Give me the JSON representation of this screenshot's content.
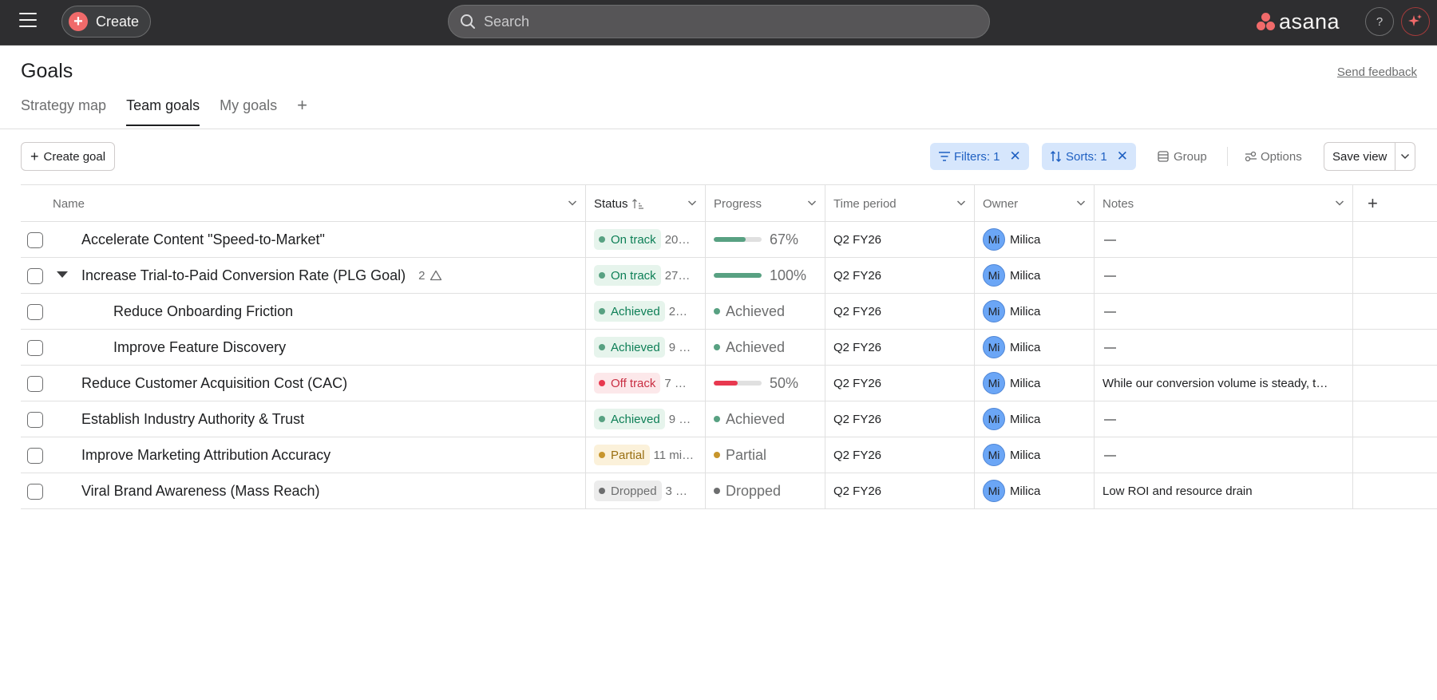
{
  "topbar": {
    "create_label": "Create",
    "search_placeholder": "Search",
    "logo_text": "asana",
    "help_label": "?",
    "icons": [
      "hamburger-icon",
      "plus-icon",
      "search-icon",
      "asana-logo",
      "help-icon",
      "ai-sparkle-icon"
    ],
    "colors": {
      "bar": "#2e2e30",
      "brand": "#f06a6a"
    }
  },
  "header": {
    "title": "Goals",
    "feedback_label": "Send feedback",
    "tabs": [
      {
        "label": "Strategy map",
        "active": false
      },
      {
        "label": "Team goals",
        "active": true
      },
      {
        "label": "My goals",
        "active": false
      }
    ],
    "add_tab_label": "+"
  },
  "toolbar": {
    "create_goal_label": "Create goal",
    "filters_label": "Filters: 1",
    "sorts_label": "Sorts: 1",
    "group_label": "Group",
    "options_label": "Options",
    "save_view_label": "Save view"
  },
  "table": {
    "columns": {
      "name": "Name",
      "status": "Status",
      "progress": "Progress",
      "time_period": "Time period",
      "owner": "Owner",
      "notes": "Notes",
      "add": "+"
    },
    "rows": [
      {
        "name": "Accelerate Content \"Speed-to-Market\"",
        "status": "On track",
        "status_date": "20…",
        "status_color": "#58a182",
        "status_bg": "#e6f4ec",
        "status_fg": "#0d7f56",
        "progress_kind": "bar",
        "progress_value": 0.67,
        "progress_text": "67%",
        "progress_color": "#58a182",
        "time_period": "Q2 FY26",
        "owner_initials": "Mi",
        "owner_name": "Milica",
        "notes": "—"
      },
      {
        "name": "Increase Trial-to-Paid Conversion Rate (PLG Goal)",
        "subgoal_count": "2",
        "status": "On track",
        "status_date": "27…",
        "status_color": "#58a182",
        "status_bg": "#e6f4ec",
        "status_fg": "#0d7f56",
        "progress_kind": "bar",
        "progress_value": 1.0,
        "progress_text": "100%",
        "progress_color": "#58a182",
        "time_period": "Q2 FY26",
        "owner_initials": "Mi",
        "owner_name": "Milica",
        "notes": "—"
      },
      {
        "name": "Reduce Onboarding Friction",
        "status": "Achieved",
        "status_date": "2…",
        "status_color": "#58a182",
        "status_bg": "#e6f4ec",
        "status_fg": "#0d7f56",
        "progress_kind": "label",
        "progress_text": "Achieved",
        "progress_color": "#58a182",
        "time_period": "Q2 FY26",
        "owner_initials": "Mi",
        "owner_name": "Milica",
        "notes": "—"
      },
      {
        "name": "Improve Feature Discovery",
        "status": "Achieved",
        "status_date": "9 …",
        "status_color": "#58a182",
        "status_bg": "#e6f4ec",
        "status_fg": "#0d7f56",
        "progress_kind": "label",
        "progress_text": "Achieved",
        "progress_color": "#58a182",
        "time_period": "Q2 FY26",
        "owner_initials": "Mi",
        "owner_name": "Milica",
        "notes": "—"
      },
      {
        "name": "Reduce Customer Acquisition Cost (CAC)",
        "status": "Off track",
        "status_date": "7 …",
        "status_color": "#e8384f",
        "status_bg": "#fce8ea",
        "status_fg": "#c92f43",
        "progress_kind": "bar",
        "progress_value": 0.5,
        "progress_text": "50%",
        "progress_color": "#e8384f",
        "time_period": "Q2 FY26",
        "owner_initials": "Mi",
        "owner_name": "Milica",
        "notes": "While our conversion volume is steady, t…"
      },
      {
        "name": "Establish Industry Authority & Trust",
        "status": "Achieved",
        "status_date": "9 …",
        "status_color": "#58a182",
        "status_bg": "#e6f4ec",
        "status_fg": "#0d7f56",
        "progress_kind": "label",
        "progress_text": "Achieved",
        "progress_color": "#58a182",
        "time_period": "Q2 FY26",
        "owner_initials": "Mi",
        "owner_name": "Milica",
        "notes": "—"
      },
      {
        "name": "Improve Marketing Attribution Accuracy",
        "status": "Partial",
        "status_date": "11 mi…",
        "status_color": "#c7952c",
        "status_bg": "#fbf1da",
        "status_fg": "#9a6f12",
        "progress_kind": "label",
        "progress_text": "Partial",
        "progress_color": "#c7952c",
        "time_period": "Q2 FY26",
        "owner_initials": "Mi",
        "owner_name": "Milica",
        "notes": "—"
      },
      {
        "name": "Viral Brand Awareness (Mass Reach)",
        "status": "Dropped",
        "status_date": "3 …",
        "status_color": "#6d6e6f",
        "status_bg": "#ececec",
        "status_fg": "#6d6e6f",
        "progress_kind": "label",
        "progress_text": "Dropped",
        "progress_color": "#6d6e6f",
        "time_period": "Q2 FY26",
        "owner_initials": "Mi",
        "owner_name": "Milica",
        "notes": "Low ROI and resource drain"
      }
    ]
  }
}
